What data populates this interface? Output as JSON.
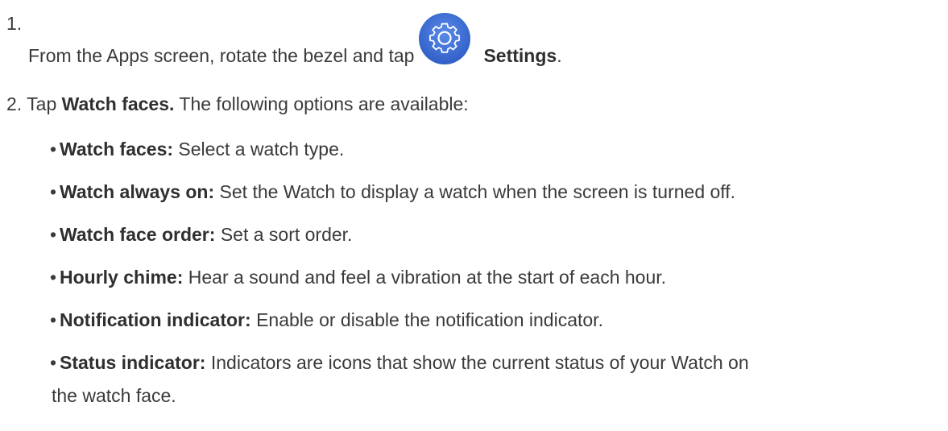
{
  "step1": {
    "number": "1.",
    "text_before": "From the Apps screen, rotate the bezel and tap",
    "icon": "settings-gear-icon",
    "bold": "Settings",
    "after": "."
  },
  "step2": {
    "number": "2.",
    "text_before": "Tap",
    "bold": "Watch faces.",
    "text_after": "The following options are available:"
  },
  "options": [
    {
      "term": "Watch faces:",
      "desc": "Select a watch type."
    },
    {
      "term": "Watch always on:",
      "desc": "Set the Watch to display a watch when the screen is turned off."
    },
    {
      "term": "Watch face order:",
      "desc": "Set a sort order."
    },
    {
      "term": "Hourly chime:",
      "desc": "Hear a sound and feel a vibration at the start of each hour."
    },
    {
      "term": "Notification indicator:",
      "desc": "Enable or disable the notification indicator."
    },
    {
      "term": "Status indicator:",
      "desc": "Indicators are icons that show the current status of your Watch on",
      "desc_cont": "the watch face."
    }
  ],
  "colors": {
    "text": "#3a3a3a",
    "icon_blue": "#3d6fd6"
  }
}
